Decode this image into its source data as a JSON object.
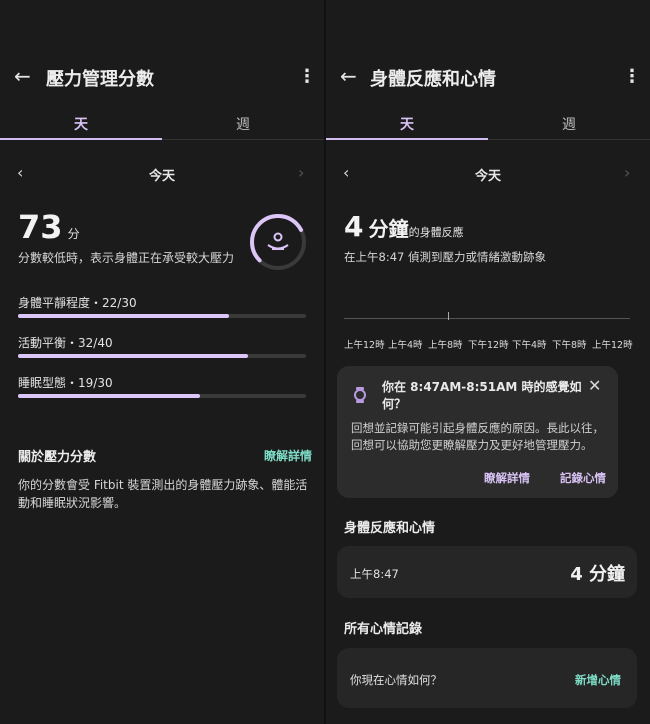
{
  "left": {
    "title": "壓力管理分數",
    "tabs": [
      "天",
      "週"
    ],
    "date": "今天",
    "score": "73",
    "score_unit": "分",
    "score_desc": "分數較低時，表示身體正在承受較大壓力",
    "metrics": [
      {
        "label": "身體平靜程度・22/30",
        "fraction": 0.733
      },
      {
        "label": "活動平衡・32/40",
        "fraction": 0.8
      },
      {
        "label": "睡眠型態・19/30",
        "fraction": 0.633
      }
    ],
    "ring_fraction": 0.73,
    "about_title": "關於壓力分數",
    "learn_more": "瞭解詳情",
    "about_text": "你的分數會受 Fitbit 裝置測出的身體壓力跡象、體能活動和睡眠狀況影響。"
  },
  "right": {
    "title": "身體反應和心情",
    "tabs": [
      "天",
      "週"
    ],
    "date": "今天",
    "duration_num": "4",
    "duration_unit": "分鐘",
    "duration_suffix": "的身體反應",
    "detected_text": "在上午8:47 偵測到壓力或情緒激動跡象",
    "timeline_labels": [
      "上午12時",
      "上午4時",
      "上午8時",
      "下午12時",
      "下午4時",
      "下午8時",
      "上午12時"
    ],
    "prompt_title": "你在 8:47AM-8:51AM 時的感覺如何？",
    "prompt_body": "回想並記錄可能引起身體反應的原因。長此以往，回想可以協助您更瞭解壓力及更好地管理壓力。",
    "prompt_learn_more": "瞭解詳情",
    "prompt_log": "記錄心情",
    "section_title": "身體反應和心情",
    "response_time": "上午8:47",
    "response_duration": "4 分鐘",
    "all_moods_title": "所有心情記錄",
    "mood_question": "你現在心情如何？",
    "add_mood": "新增心情"
  },
  "colors": {
    "accent_purple": "#d7c2f3",
    "accent_teal": "#7ddbc6"
  }
}
